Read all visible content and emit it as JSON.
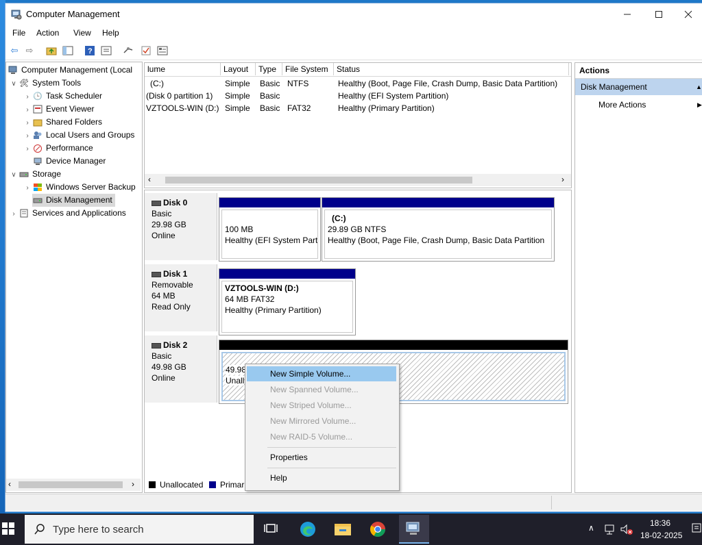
{
  "window": {
    "title": "Computer Management"
  },
  "menu": [
    "File",
    "Action",
    "View",
    "Help"
  ],
  "tree": {
    "root": "Computer Management (Local",
    "items": [
      {
        "label": "System Tools"
      },
      {
        "label": "Task Scheduler"
      },
      {
        "label": "Event Viewer"
      },
      {
        "label": "Shared Folders"
      },
      {
        "label": "Local Users and Groups"
      },
      {
        "label": "Performance"
      },
      {
        "label": "Device Manager"
      },
      {
        "label": "Storage"
      },
      {
        "label": "Windows Server Backup"
      },
      {
        "label": "Disk Management"
      },
      {
        "label": "Services and Applications"
      }
    ]
  },
  "volumes": {
    "headers": [
      "lume",
      "Layout",
      "Type",
      "File System",
      "Status"
    ],
    "rows": [
      [
        "(C:)",
        "Simple",
        "Basic",
        "NTFS",
        "Healthy (Boot, Page File, Crash Dump, Basic Data Partition)"
      ],
      [
        "(Disk 0 partition 1)",
        "Simple",
        "Basic",
        "",
        "Healthy (EFI System Partition)"
      ],
      [
        "VZTOOLS-WIN (D:)",
        "Simple",
        "Basic",
        "FAT32",
        "Healthy (Primary Partition)"
      ]
    ]
  },
  "disks": [
    {
      "name": "Disk 0",
      "type": "Basic",
      "size": "29.98 GB",
      "state": "Online",
      "partitions": [
        {
          "line1": "100 MB",
          "line2": "Healthy (EFI System Part"
        },
        {
          "title": "(C:)",
          "line1": "29.89 GB NTFS",
          "line2": "Healthy (Boot, Page File, Crash Dump, Basic Data Partition"
        }
      ]
    },
    {
      "name": "Disk 1",
      "type": "Removable",
      "size": "64 MB",
      "state": "Read Only",
      "partitions": [
        {
          "title": "VZTOOLS-WIN  (D:)",
          "line1": "64 MB FAT32",
          "line2": "Healthy (Primary Partition)"
        }
      ]
    },
    {
      "name": "Disk 2",
      "type": "Basic",
      "size": "49.98 GB",
      "state": "Online",
      "partitions": [
        {
          "line1": "49.98",
          "line2": "Unall"
        }
      ]
    }
  ],
  "legend": [
    "Unallocated",
    "Primar"
  ],
  "actions": {
    "header": "Actions",
    "section": "Disk Management",
    "items": [
      "More Actions"
    ]
  },
  "context_menu": {
    "items": [
      "New Simple Volume...",
      "New Spanned Volume...",
      "New Striped Volume...",
      "New Mirrored Volume...",
      "New RAID-5 Volume..."
    ],
    "properties": "Properties",
    "help": "Help"
  },
  "taskbar": {
    "search_placeholder": "Type here to search",
    "time": "18:36",
    "date": "18-02-2025"
  },
  "colors": {
    "primary_partition": "#00008b",
    "unallocated": "#000000",
    "highlight": "#99c9ef"
  }
}
